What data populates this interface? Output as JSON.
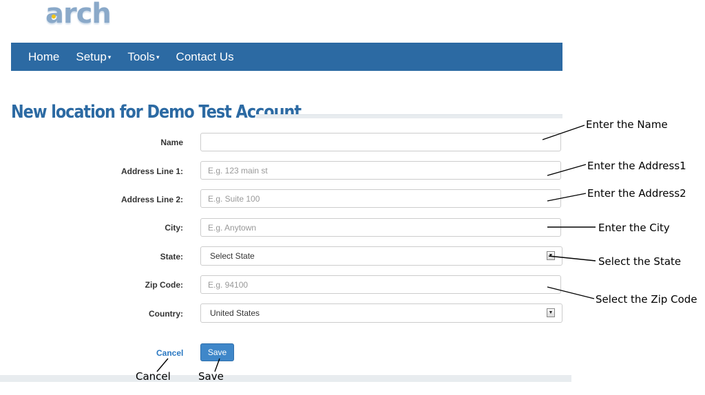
{
  "logo": {
    "text": "arch"
  },
  "nav": {
    "home": "Home",
    "setup": "Setup",
    "tools": "Tools",
    "contact": "Contact Us",
    "caret": "▾"
  },
  "page": {
    "title": "New location for Demo Test Account"
  },
  "form": {
    "name_label": "Name",
    "address1_label": "Address Line 1:",
    "address1_placeholder": "E.g. 123 main st",
    "address2_label": "Address Line 2:",
    "address2_placeholder": "E.g. Suite 100",
    "city_label": "City:",
    "city_placeholder": "E.g. Anytown",
    "state_label": "State:",
    "state_value": "Select State",
    "zip_label": "Zip Code:",
    "zip_placeholder": "E.g. 94100",
    "country_label": "Country:",
    "country_value": "United States",
    "select_arrow": "▼"
  },
  "actions": {
    "cancel": "Cancel",
    "save": "Save"
  },
  "annotations": {
    "name": "Enter the Name",
    "address1": "Enter the Address1",
    "address2": "Enter the Address2",
    "city": "Enter the City",
    "state": "Select the State",
    "zip": "Select the Zip Code",
    "cancel": "Cancel",
    "save": "Save"
  },
  "colors": {
    "navbar": "#2c6aa3",
    "title": "#2c6aa3",
    "save_button": "#3f87c9",
    "link": "#2a78c2"
  }
}
